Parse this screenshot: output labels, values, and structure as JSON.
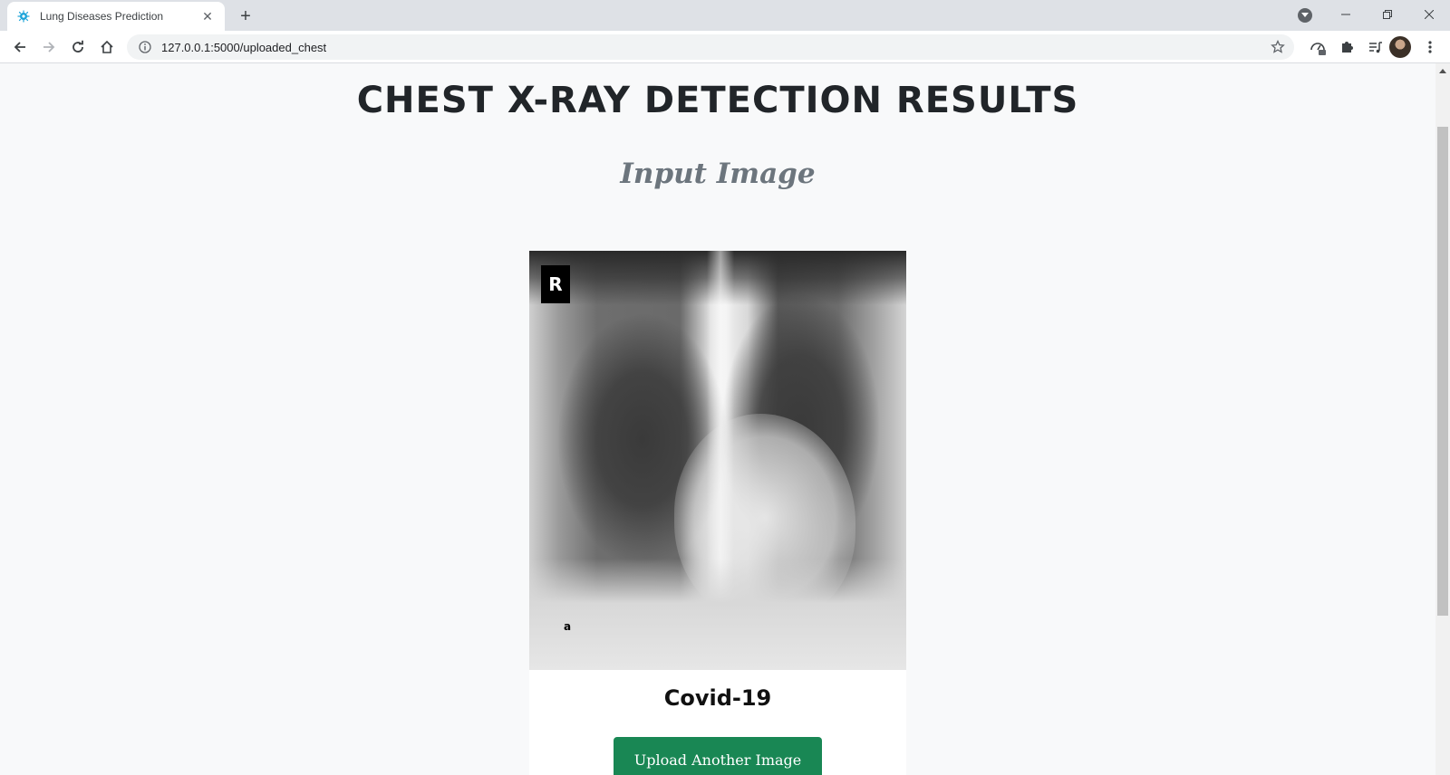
{
  "browser": {
    "tab_title": "Lung Diseases Prediction",
    "tab_favicon": "virus-icon",
    "url": "127.0.0.1:5000/uploaded_chest"
  },
  "page": {
    "title": "CHEST X-RAY DETECTION RESULTS",
    "subheading": "Input Image",
    "xray_marker": "R",
    "xray_letter": "a",
    "result_label": "Covid-19",
    "upload_button_label": "Upload Another Image"
  },
  "colors": {
    "button": "#198754",
    "title": "#212529",
    "subheading": "#6c757d",
    "page_background": "#f8f9fa"
  }
}
